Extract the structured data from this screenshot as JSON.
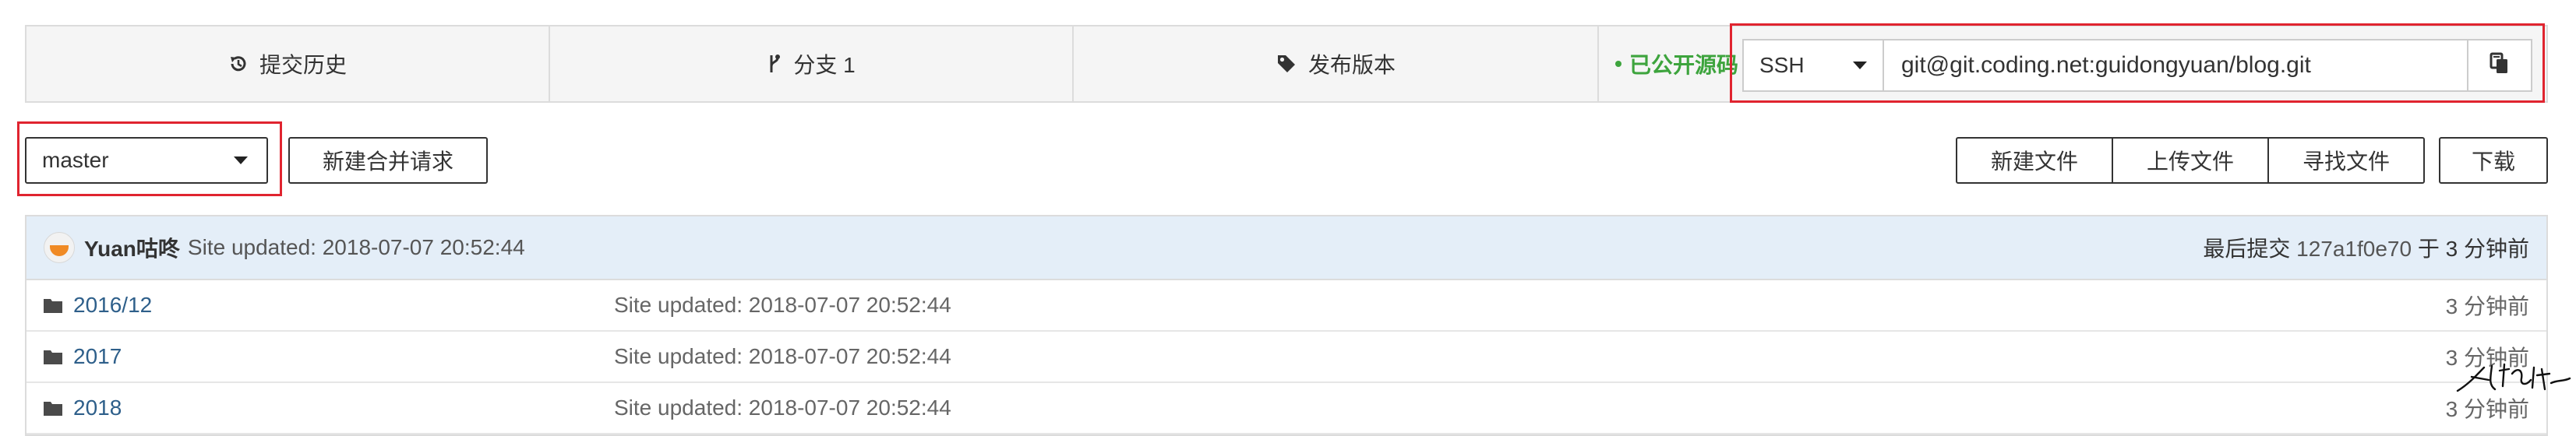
{
  "repo_info": {
    "history_label": "提交历史",
    "branch_label": "分支 1",
    "release_label": "发布版本",
    "public_label": "已公开源码"
  },
  "clone": {
    "protocol": "SSH",
    "url": "git@git.coding.net:guidongyuan/blog.git"
  },
  "toolbar": {
    "branch": "master",
    "merge_request_label": "新建合并请求",
    "new_file_label": "新建文件",
    "upload_file_label": "上传文件",
    "find_file_label": "寻找文件",
    "download_label": "下载"
  },
  "last_commit": {
    "author": "Yuan咕咚",
    "message": "Site updated: 2018-07-07 20:52:44",
    "prefix": "最后提交",
    "hash": "127a1f0e70",
    "suffix": "于 3 分钟前"
  },
  "files": [
    {
      "name": "2016/12",
      "message": "Site updated: 2018-07-07 20:52:44",
      "time": "3 分钟前"
    },
    {
      "name": "2017",
      "message": "Site updated: 2018-07-07 20:52:44",
      "time": "3 分钟前"
    },
    {
      "name": "2018",
      "message": "Site updated: 2018-07-07 20:52:44",
      "time": "3 分钟前"
    }
  ],
  "colors": {
    "accent_green": "#3da43d",
    "highlight_red": "#e0242f",
    "commit_bar": "#e4eef8",
    "link_blue": "#2e5f8a"
  }
}
